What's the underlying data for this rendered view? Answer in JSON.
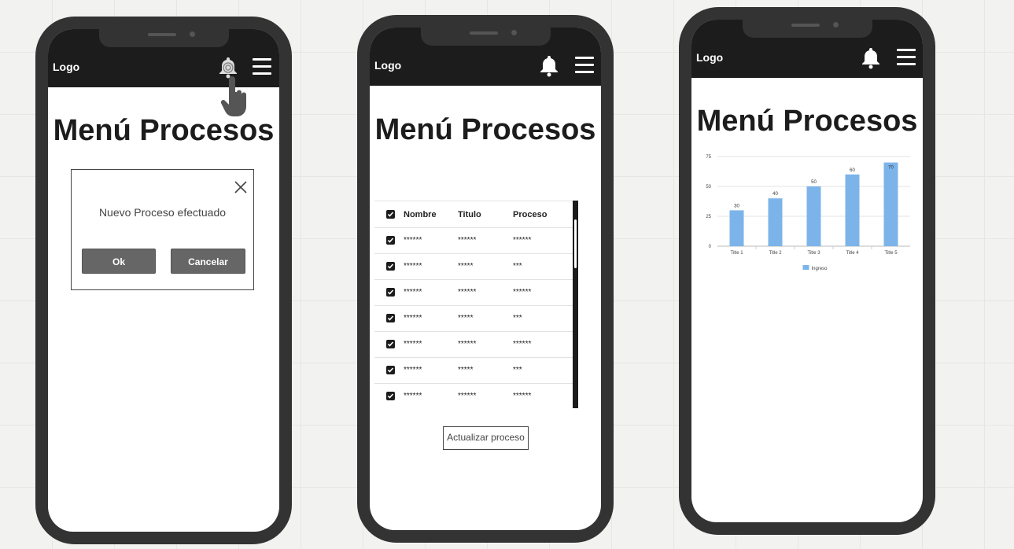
{
  "phones": [
    {
      "logo": "Logo",
      "title": "Menú Procesos",
      "dialog": {
        "message": "Nuevo Proceso efectuado",
        "ok_label": "Ok",
        "cancel_label": "Cancelar"
      }
    },
    {
      "logo": "Logo",
      "title": "Menú Procesos",
      "table": {
        "headers": [
          "Nombre",
          "Titulo",
          "Proceso"
        ],
        "rows": [
          [
            "******",
            "******",
            "******"
          ],
          [
            "******",
            "*****",
            "***"
          ],
          [
            "******",
            "******",
            "******"
          ],
          [
            "******",
            "*****",
            "***"
          ],
          [
            "******",
            "******",
            "******"
          ],
          [
            "******",
            "*****",
            "***"
          ],
          [
            "******",
            "******",
            "******"
          ]
        ]
      },
      "update_label": "Actualizar proceso"
    },
    {
      "logo": "Logo",
      "title": "Menú Procesos"
    }
  ],
  "colors": {
    "header": "#1c1c1c",
    "phone_frame": "#333333",
    "bar": "#7cb4ea",
    "button": "#666666"
  },
  "icons": [
    "bell-icon",
    "menu-icon",
    "hand-pointer-icon",
    "close-icon",
    "checkbox-icon"
  ],
  "chart_data": {
    "type": "bar",
    "categories": [
      "Title 1",
      "Title 2",
      "Title 3",
      "Title 4",
      "Title 5"
    ],
    "series": [
      {
        "name": "Ingreso",
        "values": [
          30,
          40,
          50,
          60,
          70
        ]
      }
    ],
    "ylim": [
      0,
      75
    ],
    "yticks": [
      0,
      25,
      50,
      75
    ],
    "data_labels": true,
    "grid": true,
    "legend": "bottom"
  }
}
